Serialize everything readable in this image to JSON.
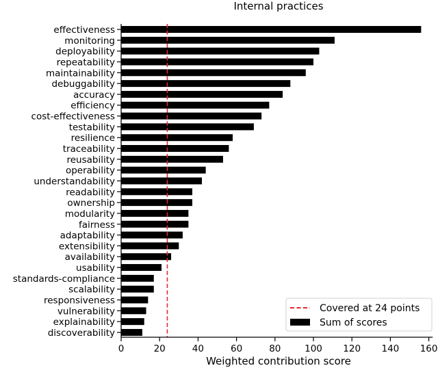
{
  "chart_data": {
    "type": "bar",
    "orientation": "horizontal",
    "title": "Internal practices",
    "xlabel": "Weighted contribution score",
    "ylabel": "",
    "xlim": [
      0,
      162
    ],
    "xticks": [
      0,
      20,
      40,
      60,
      80,
      100,
      120,
      140,
      160
    ],
    "grid": false,
    "legend_position": "bottom-right",
    "categories": [
      "effectiveness",
      "monitoring",
      "deployability",
      "repeatability",
      "maintainability",
      "debuggability",
      "accuracy",
      "efficiency",
      "cost-effectiveness",
      "testability",
      "resilience",
      "traceability",
      "reusability",
      "operability",
      "understandability",
      "readability",
      "ownership",
      "modularity",
      "fairness",
      "adaptability",
      "extensibility",
      "availability",
      "usability",
      "standards-compliance",
      "scalability",
      "responsiveness",
      "vulnerability",
      "explainability",
      "discoverability"
    ],
    "series": [
      {
        "name": "Sum of scores",
        "color": "#000000",
        "values": [
          156,
          111,
          103,
          100,
          96,
          88,
          84,
          77,
          73,
          69,
          58,
          56,
          53,
          44,
          42,
          37,
          37,
          35,
          35,
          32,
          30,
          26,
          21,
          17,
          17,
          14,
          13,
          12,
          11
        ]
      }
    ],
    "reference_line": {
      "name": "Covered at 24 points",
      "value": 24,
      "color": "#e8262a",
      "style": "dashed"
    },
    "legend": [
      {
        "label": "Covered at 24 points",
        "kind": "dashed-line",
        "color": "#e8262a"
      },
      {
        "label": "Sum of scores",
        "kind": "patch",
        "color": "#000000"
      }
    ]
  }
}
